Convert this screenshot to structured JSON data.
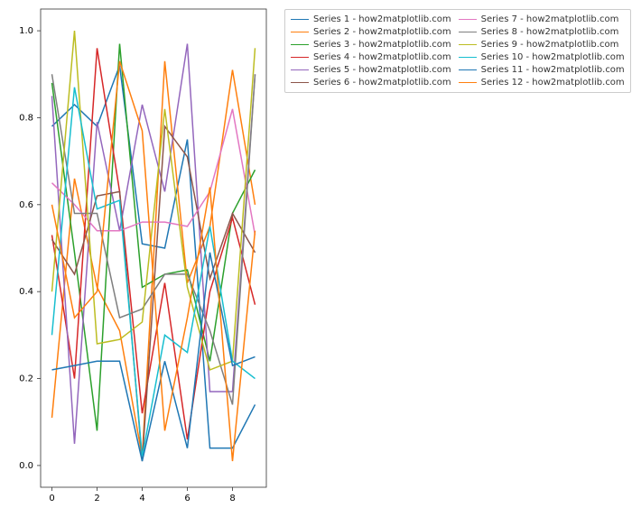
{
  "chart_data": {
    "type": "line",
    "x": [
      0,
      1,
      2,
      3,
      4,
      5,
      6,
      7,
      8,
      9
    ],
    "xlim": [
      -0.5,
      9.5
    ],
    "ylim": [
      -0.05,
      1.05
    ],
    "xticks": [
      0,
      2,
      4,
      6,
      8
    ],
    "yticks": [
      0.0,
      0.2,
      0.4,
      0.6,
      0.8,
      1.0
    ],
    "colors": {
      "s1": "#1f77b4",
      "s2": "#ff7f0e",
      "s3": "#2ca02c",
      "s4": "#d62728",
      "s5": "#9467bd",
      "s6": "#8c564b",
      "s7": "#e377c2",
      "s8": "#7f7f7f",
      "s9": "#bcbd22",
      "s10": "#17becf",
      "s11": "#1f77b4",
      "s12": "#ff7f0e"
    },
    "series": [
      {
        "id": "s1",
        "name": "Series 1 - how2matplotlib.com",
        "values": [
          0.78,
          0.83,
          0.78,
          0.92,
          0.51,
          0.5,
          0.75,
          0.04,
          0.04,
          0.14
        ]
      },
      {
        "id": "s2",
        "name": "Series 2 - how2matplotlib.com",
        "values": [
          0.11,
          0.66,
          0.41,
          0.31,
          0.02,
          0.93,
          0.42,
          0.55,
          0.91,
          0.6
        ]
      },
      {
        "id": "s3",
        "name": "Series 3 - how2matplotlib.com",
        "values": [
          0.88,
          0.49,
          0.08,
          0.97,
          0.41,
          0.44,
          0.45,
          0.24,
          0.58,
          0.68
        ]
      },
      {
        "id": "s4",
        "name": "Series 4 - how2matplotlib.com",
        "values": [
          0.53,
          0.2,
          0.96,
          0.63,
          0.12,
          0.42,
          0.06,
          0.4,
          0.57,
          0.37
        ]
      },
      {
        "id": "s5",
        "name": "Series 5 - how2matplotlib.com",
        "values": [
          0.85,
          0.05,
          0.79,
          0.54,
          0.83,
          0.63,
          0.97,
          0.17,
          0.17,
          0.9
        ]
      },
      {
        "id": "s6",
        "name": "Series 6 - how2matplotlib.com",
        "values": [
          0.52,
          0.44,
          0.62,
          0.63,
          0.01,
          0.78,
          0.71,
          0.43,
          0.58,
          0.49
        ]
      },
      {
        "id": "s7",
        "name": "Series 7 - how2matplotlib.com",
        "values": [
          0.65,
          0.6,
          0.54,
          0.54,
          0.56,
          0.56,
          0.55,
          0.63,
          0.82,
          0.53
        ]
      },
      {
        "id": "s8",
        "name": "Series 8 - how2matplotlib.com",
        "values": [
          0.9,
          0.58,
          0.58,
          0.34,
          0.36,
          0.44,
          0.44,
          0.31,
          0.14,
          0.9
        ]
      },
      {
        "id": "s9",
        "name": "Series 9 - how2matplotlib.com",
        "values": [
          0.4,
          1.0,
          0.28,
          0.29,
          0.33,
          0.82,
          0.41,
          0.22,
          0.24,
          0.96
        ]
      },
      {
        "id": "s10",
        "name": "Series 10 - how2matplotlib.com",
        "values": [
          0.3,
          0.87,
          0.59,
          0.61,
          0.02,
          0.3,
          0.26,
          0.55,
          0.24,
          0.2
        ]
      },
      {
        "id": "s11",
        "name": "Series 11 - how2matplotlib.com",
        "values": [
          0.22,
          0.23,
          0.24,
          0.24,
          0.01,
          0.24,
          0.04,
          0.49,
          0.23,
          0.25
        ]
      },
      {
        "id": "s12",
        "name": "Series 12 - how2matplotlib.com",
        "values": [
          0.6,
          0.34,
          0.4,
          0.93,
          0.77,
          0.08,
          0.34,
          0.64,
          0.01,
          0.54
        ]
      }
    ]
  },
  "legend": {
    "col1": [
      {
        "id": "s1",
        "label": "Series 1 - how2matplotlib.com"
      },
      {
        "id": "s2",
        "label": "Series 2 - how2matplotlib.com"
      },
      {
        "id": "s3",
        "label": "Series 3 - how2matplotlib.com"
      },
      {
        "id": "s4",
        "label": "Series 4 - how2matplotlib.com"
      },
      {
        "id": "s5",
        "label": "Series 5 - how2matplotlib.com"
      },
      {
        "id": "s6",
        "label": "Series 6 - how2matplotlib.com"
      }
    ],
    "col2": [
      {
        "id": "s7",
        "label": "Series 7 - how2matplotlib.com"
      },
      {
        "id": "s8",
        "label": "Series 8 - how2matplotlib.com"
      },
      {
        "id": "s9",
        "label": "Series 9 - how2matplotlib.com"
      },
      {
        "id": "s10",
        "label": "Series 10 - how2matplotlib.com"
      },
      {
        "id": "s11",
        "label": "Series 11 - how2matplotlib.com"
      },
      {
        "id": "s12",
        "label": "Series 12 - how2matplotlib.com"
      }
    ]
  },
  "ytick_labels": [
    "0.0",
    "0.2",
    "0.4",
    "0.6",
    "0.8",
    "1.0"
  ],
  "xtick_labels": [
    "0",
    "2",
    "4",
    "6",
    "8"
  ]
}
